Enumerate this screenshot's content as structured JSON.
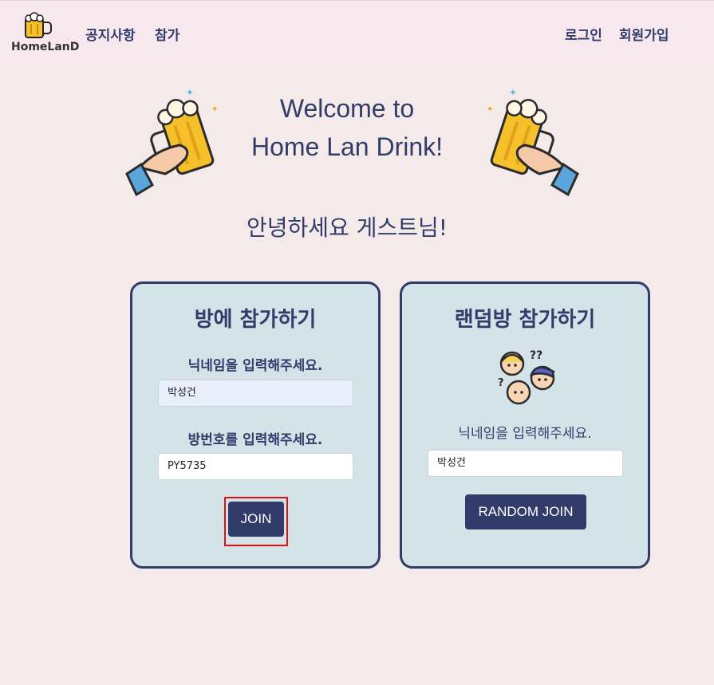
{
  "header": {
    "logo_text": "HomeLanD",
    "nav": [
      {
        "label": "공지사항"
      },
      {
        "label": "참가"
      }
    ],
    "login_label": "로그인",
    "signup_label": "회원가입"
  },
  "hero": {
    "title_line1": "Welcome to",
    "title_line2": "Home Lan Drink!",
    "greeting": "안녕하세요 게스트님!"
  },
  "join_room": {
    "title": "방에 참가하기",
    "nickname_label": "닉네임을 입력해주세요.",
    "nickname_value": "박성건",
    "room_label": "방번호를 입력해주세요.",
    "room_value": "PY5735",
    "button_label": "JOIN"
  },
  "random_room": {
    "title": "랜덤방 참가하기",
    "nickname_label": "닉네임을 입력해주세요.",
    "nickname_value": "박성건",
    "button_label": "RANDOM JOIN"
  },
  "colors": {
    "primary": "#323c6b",
    "card_bg": "#d3e3e8",
    "page_bg": "#f5eaea",
    "highlight": "#e01010"
  }
}
